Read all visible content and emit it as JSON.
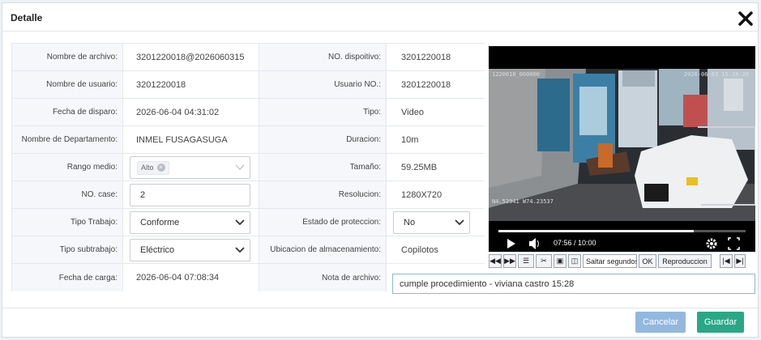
{
  "dialog": {
    "title": "Detalle"
  },
  "rows": [
    {
      "label1": "Nombre de archivo:",
      "value1": "3201220018@2026060315",
      "label2": "NO. dispoitivo:",
      "value2": "3201220018"
    },
    {
      "label1": "Nombre de usuario:",
      "value1": "3201220018",
      "label2": "Usuario NO.:",
      "value2": "3201220018"
    },
    {
      "label1": "Fecha de disparo:",
      "value1": "2026-06-04 04:31:02",
      "label2": "Tipo:",
      "value2": "Video"
    },
    {
      "label1": "Nombre de Departamento:",
      "value1": "INMEL FUSAGASUGA",
      "label2": "Duracion:",
      "value2": "10m"
    },
    {
      "label1": "Rango medio:",
      "value1": "Alto",
      "label2": "Tamaño:",
      "value2": "59.25MB"
    },
    {
      "label1": "NO. case:",
      "value1": "2",
      "label2": "Resolucion:",
      "value2": "1280X720"
    },
    {
      "label1": "Tipo Trabajo:",
      "value1": "Conforme",
      "label2": "Estado de proteccion:",
      "value2": "No"
    },
    {
      "label1": "Tipo subtrabajo:",
      "value1": "Eléctrico",
      "label2": "Ubicacion de almacenamiento:",
      "value2": "Copilotos"
    },
    {
      "label1": "Fecha de carga:",
      "value1": "2026-06-04 07:08:34",
      "label2": "Nota de archivo:",
      "value2": "cumple procedimiento - viviana castro 15:28"
    }
  ],
  "video": {
    "overlay_top_left": "1220018_000000",
    "overlay_top_right": "2026-06-03 15:28:20",
    "overlay_bottom_left": "N4.52941 W74.23537",
    "time": "07:56 / 10:00",
    "progress": 0.79,
    "controls": {
      "seek_placeholder": "Saltar segundos",
      "ok": "OK",
      "playback": "Reproduccion"
    }
  },
  "buttons": {
    "cancel": "Cancelar",
    "save": "Guardar"
  },
  "colors": {
    "save": "#2aa786",
    "cancel": "#93b8e0"
  }
}
